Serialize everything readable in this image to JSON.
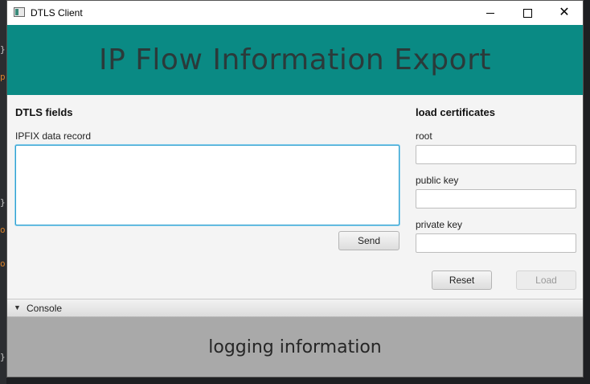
{
  "window": {
    "title": "DTLS Client",
    "minimize_glyph": "",
    "maximize_glyph": "",
    "close_glyph": "✕"
  },
  "header": {
    "title": "IP Flow Information Export",
    "background_color": "#0a8a84"
  },
  "dtls_section": {
    "heading": "DTLS fields",
    "record_label": "IPFIX data record",
    "record_value": "",
    "send_label": "Send"
  },
  "certificates_section": {
    "heading": "load certificates",
    "root_label": "root",
    "root_value": "",
    "public_key_label": "public key",
    "public_key_value": "",
    "private_key_label": "private key",
    "private_key_value": "",
    "reset_label": "Reset",
    "load_label": "Load"
  },
  "console": {
    "label": "Console",
    "arrow": "▼",
    "message": "logging information"
  },
  "editor_gutter": {
    "glyphs": [
      "}",
      "p",
      "}",
      "o",
      "o",
      "}"
    ]
  }
}
